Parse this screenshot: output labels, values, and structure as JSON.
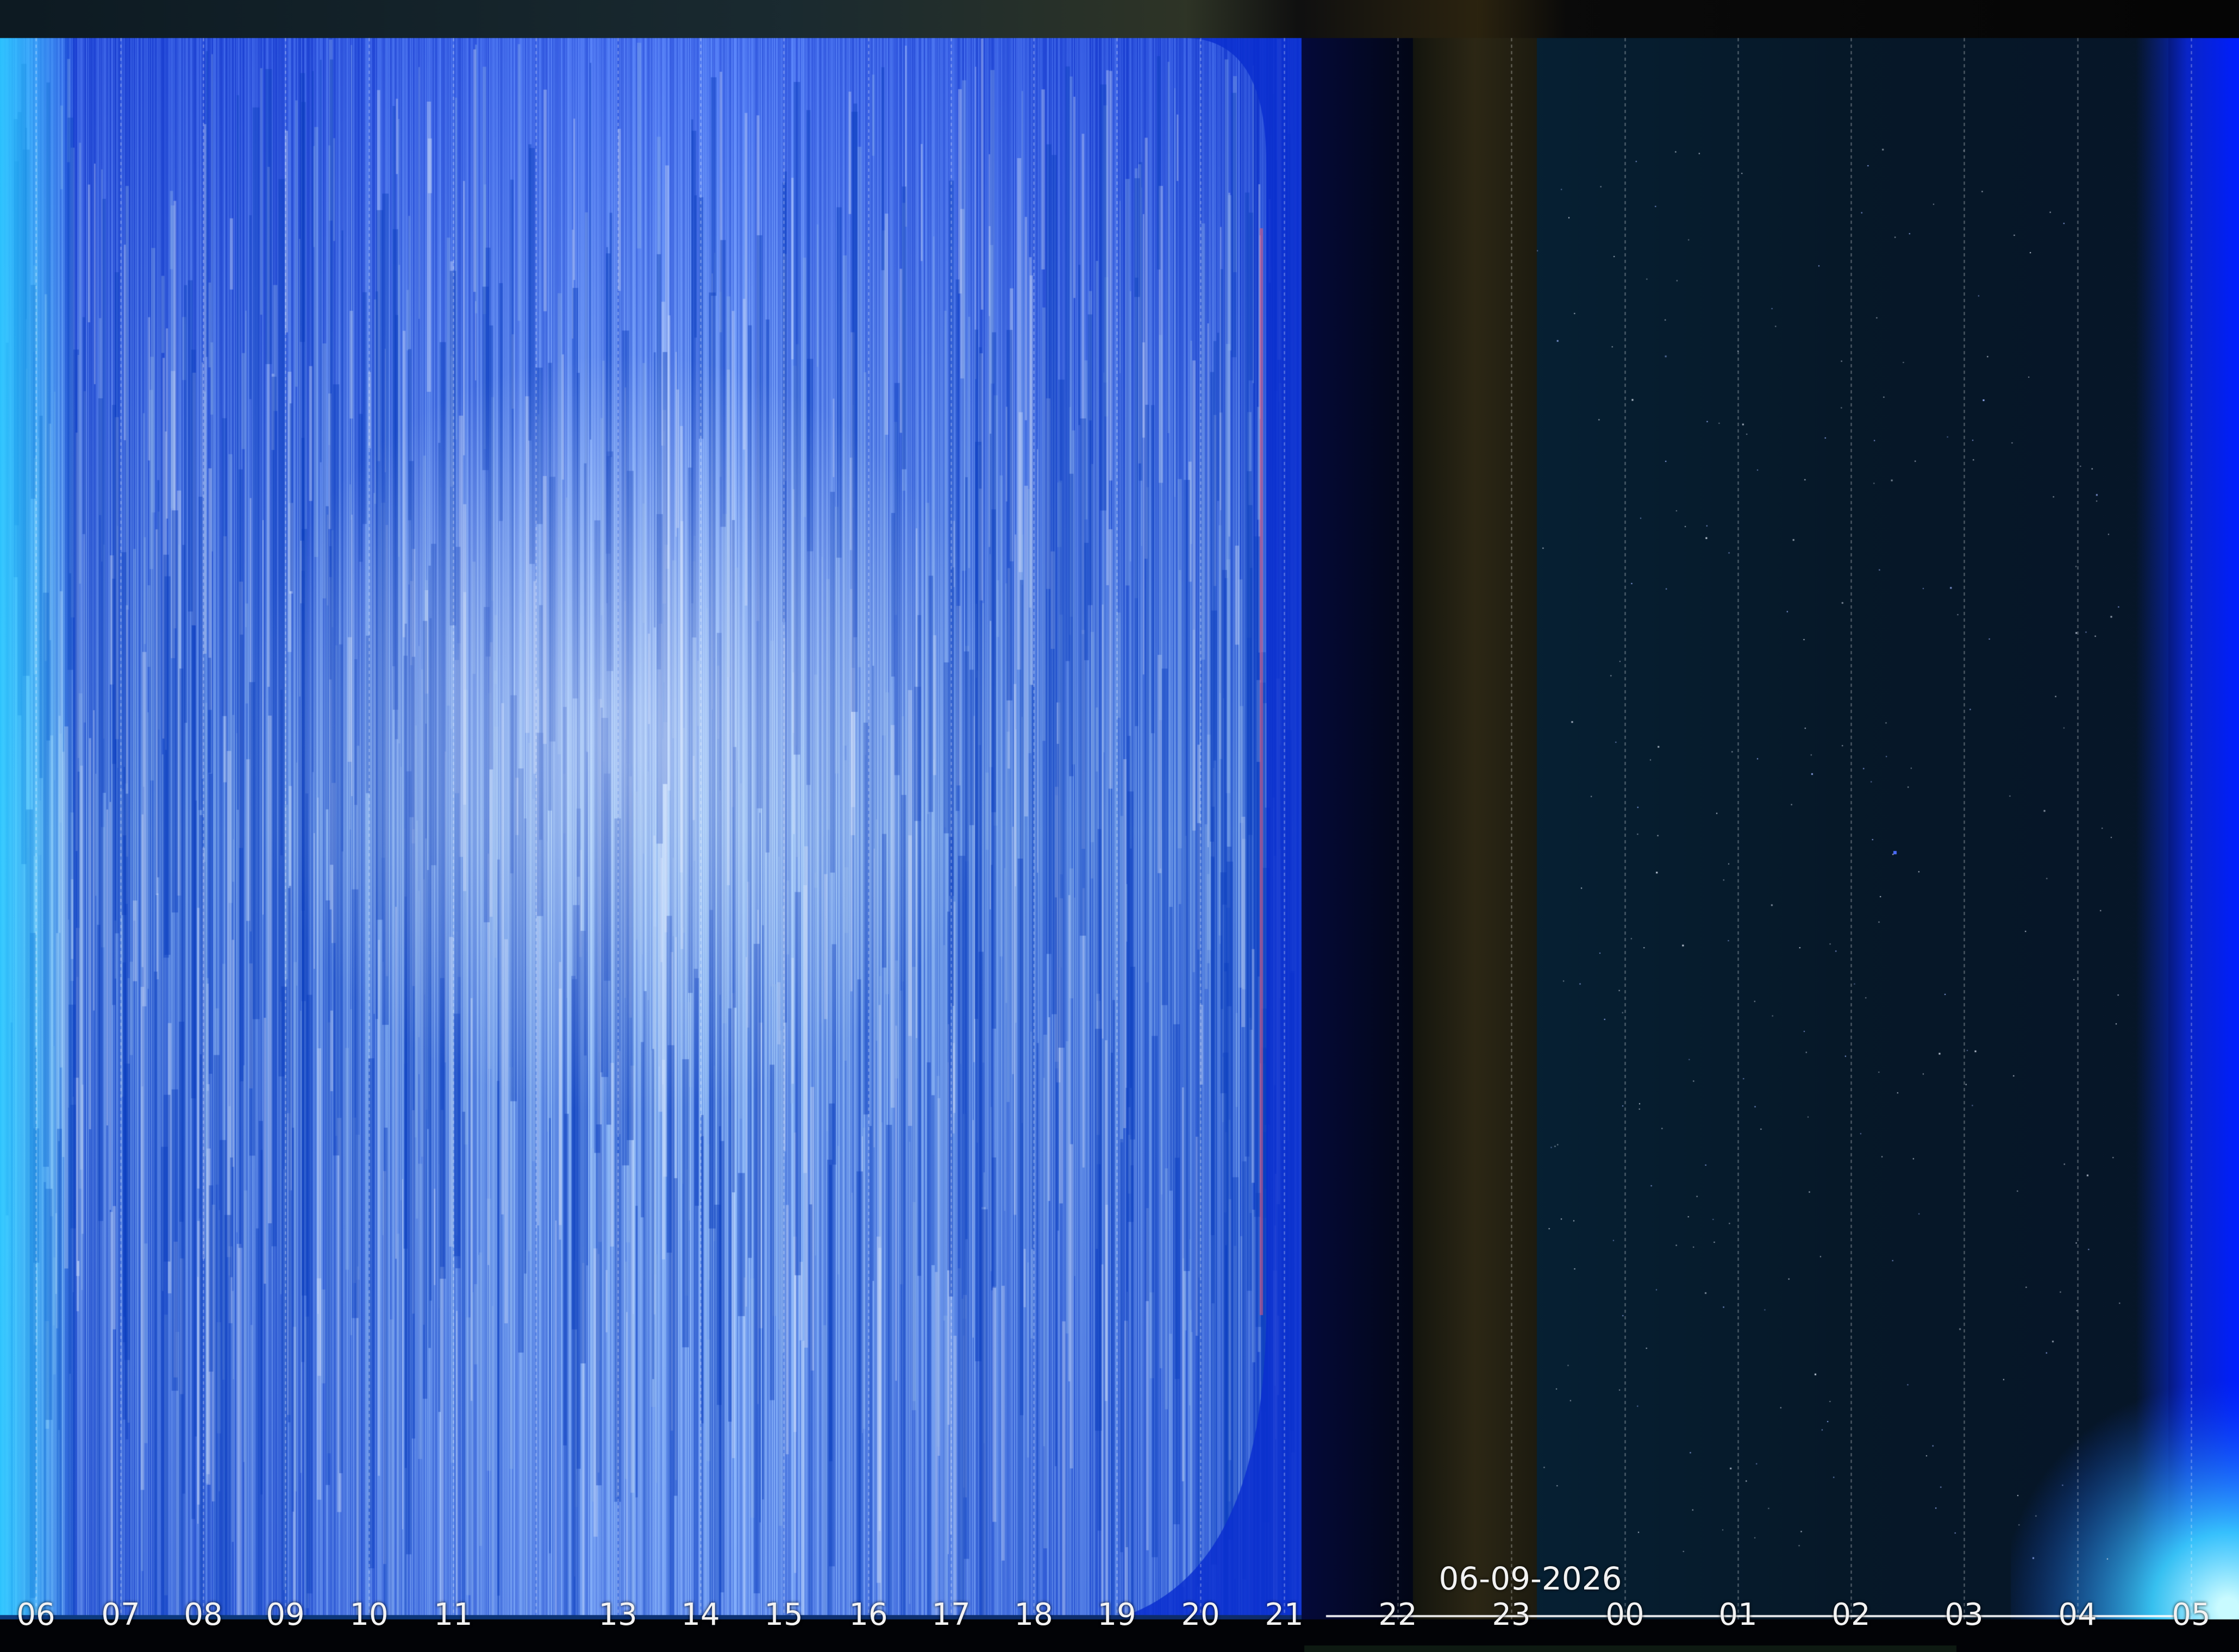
{
  "date": "06-09-2026",
  "hour_labels": [
    "06",
    "07",
    "08",
    "09",
    "10",
    "11",
    "13",
    "14",
    "15",
    "16",
    "17",
    "18",
    "19",
    "20",
    "21",
    "22",
    "23",
    "00",
    "01",
    "02",
    "03",
    "04",
    "05"
  ],
  "colors": {
    "day_sky": "#2f6fd6",
    "day_highlight": "#c9dcf5",
    "twilight": "#0a2cc9",
    "night_sky": "#06182a",
    "dusk_band": "#2a2413",
    "dawn_glow": "#3fd8ff",
    "label_text": "#f2f2f2"
  }
}
